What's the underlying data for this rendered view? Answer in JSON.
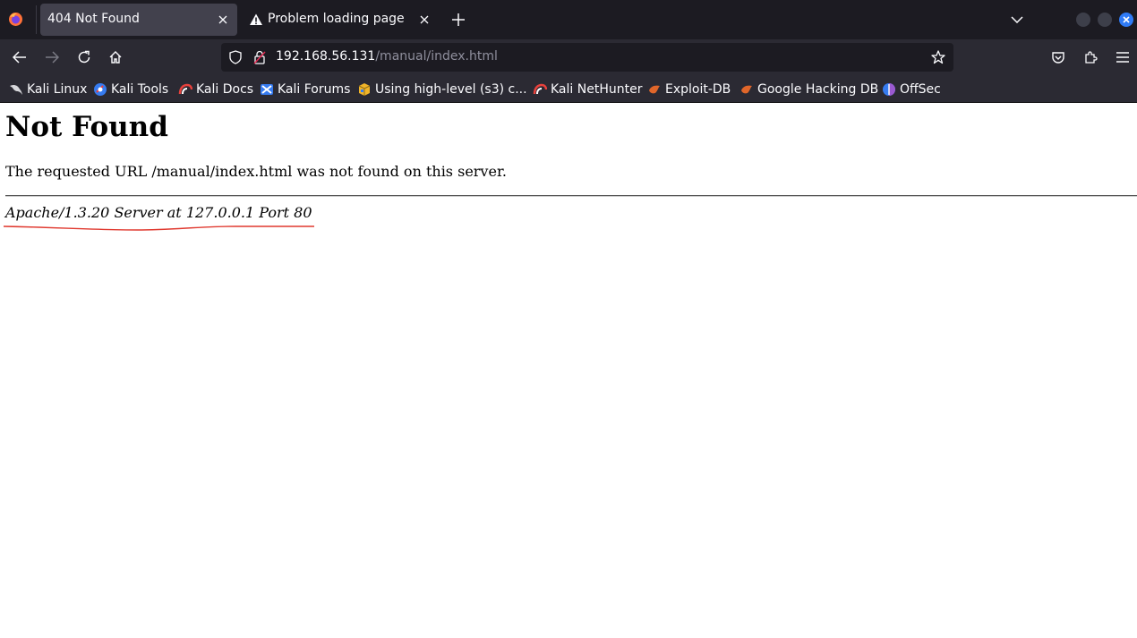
{
  "browser": {
    "tabs": [
      {
        "title": "404 Not Found",
        "active": true
      },
      {
        "title": "Problem loading page",
        "active": false
      }
    ],
    "url": {
      "host": "192.168.56.131",
      "path": "/manual/index.html"
    },
    "bookmarks": [
      {
        "label": "Kali Linux",
        "icon": "kali-dragon-icon"
      },
      {
        "label": "Kali Tools",
        "icon": "kali-tools-icon"
      },
      {
        "label": "Kali Docs",
        "icon": "kali-docs-icon"
      },
      {
        "label": "Kali Forums",
        "icon": "kali-forums-icon"
      },
      {
        "label": "Using high-level (s3) c...",
        "icon": "package-icon"
      },
      {
        "label": "Kali NetHunter",
        "icon": "nethunter-icon"
      },
      {
        "label": "Exploit-DB",
        "icon": "exploit-db-icon"
      },
      {
        "label": "Google Hacking DB",
        "icon": "ghdb-icon"
      },
      {
        "label": "OffSec",
        "icon": "offsec-icon"
      }
    ],
    "colors": {
      "tabstrip": "#1c1b22",
      "toolbar": "#2b2a33",
      "active_tab": "#42414d",
      "close_button": "#2f7bf6",
      "annotation": "#e0392f"
    }
  },
  "page": {
    "heading": "Not Found",
    "message": "The requested URL /manual/index.html was not found on this server.",
    "server_signature": "Apache/1.3.20 Server at 127.0.0.1 Port 80"
  }
}
